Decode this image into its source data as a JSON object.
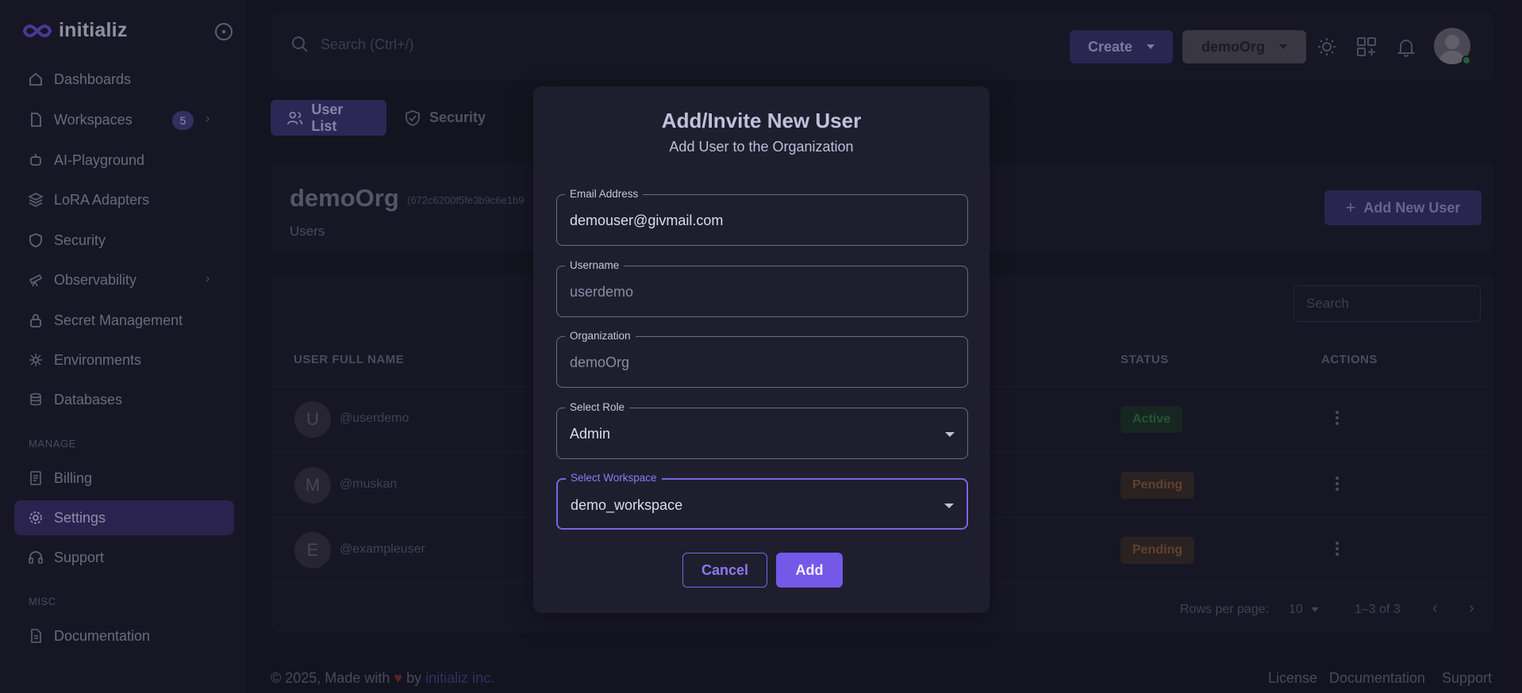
{
  "app": {
    "name": "initializ"
  },
  "sidebar": {
    "items": [
      {
        "label": "Dashboards",
        "icon": "home-icon"
      },
      {
        "label": "Workspaces",
        "icon": "file-icon",
        "badge": "5"
      },
      {
        "label": "AI-Playground",
        "icon": "robot-icon"
      },
      {
        "label": "LoRA Adapters",
        "icon": "layers-icon"
      },
      {
        "label": "Security",
        "icon": "shield-icon"
      },
      {
        "label": "Observability",
        "icon": "telescope-icon"
      },
      {
        "label": "Secret Management",
        "icon": "lock-icon"
      },
      {
        "label": "Environments",
        "icon": "network-icon"
      },
      {
        "label": "Databases",
        "icon": "database-icon"
      }
    ],
    "manage_label": "MANAGE",
    "manage_items": [
      {
        "label": "Billing",
        "icon": "receipt-icon"
      },
      {
        "label": "Settings",
        "icon": "gear-icon"
      },
      {
        "label": "Support",
        "icon": "headset-icon"
      }
    ],
    "misc_label": "MISC",
    "misc_items": [
      {
        "label": "Documentation",
        "icon": "document-icon"
      }
    ]
  },
  "topbar": {
    "search_placeholder": "Search (Ctrl+/)",
    "create_label": "Create",
    "org_label": "demoOrg"
  },
  "tabs": [
    {
      "label": "User List",
      "icon": "users-icon"
    },
    {
      "label": "Security",
      "icon": "shield-check-icon"
    }
  ],
  "org": {
    "name": "demoOrg",
    "id": "(672c6200f5fe3b9c6e1b9",
    "subtitle": "Users",
    "add_button": "Add New User"
  },
  "table": {
    "search_placeholder": "Search",
    "headers": [
      "USER FULL NAME",
      "STATUS",
      "ACTIONS"
    ],
    "rows": [
      {
        "initial": "U",
        "username": "@userdemo",
        "status": "Active"
      },
      {
        "initial": "M",
        "username": "@muskan",
        "status": "Pending"
      },
      {
        "initial": "E",
        "username": "@exampleuser",
        "status": "Pending"
      }
    ],
    "rows_per_page_label": "Rows per page:",
    "rows_per_page": "10",
    "range": "1–3 of 3"
  },
  "footer": {
    "copyright": "© 2025, Made with",
    "heart": "♥",
    "by": "by",
    "brand": "initializ inc.",
    "links": [
      "License",
      "Documentation",
      "Support"
    ]
  },
  "modal": {
    "title": "Add/Invite New User",
    "subtitle": "Add User to the Organization",
    "fields": [
      {
        "label": "Email Address",
        "value": "demouser@givmail.com"
      },
      {
        "label": "Username",
        "value": "userdemo"
      },
      {
        "label": "Organization",
        "value": "demoOrg"
      },
      {
        "label": "Select Role",
        "value": "Admin"
      },
      {
        "label": "Select Workspace",
        "value": "demo_workspace"
      }
    ],
    "cancel_label": "Cancel",
    "add_label": "Add"
  },
  "colors": {
    "accent": "#7459e8",
    "background": "#181725",
    "surface": "#1c1b2b",
    "active_status": "#2f7b4d",
    "pending_status": "#8c5e36"
  }
}
